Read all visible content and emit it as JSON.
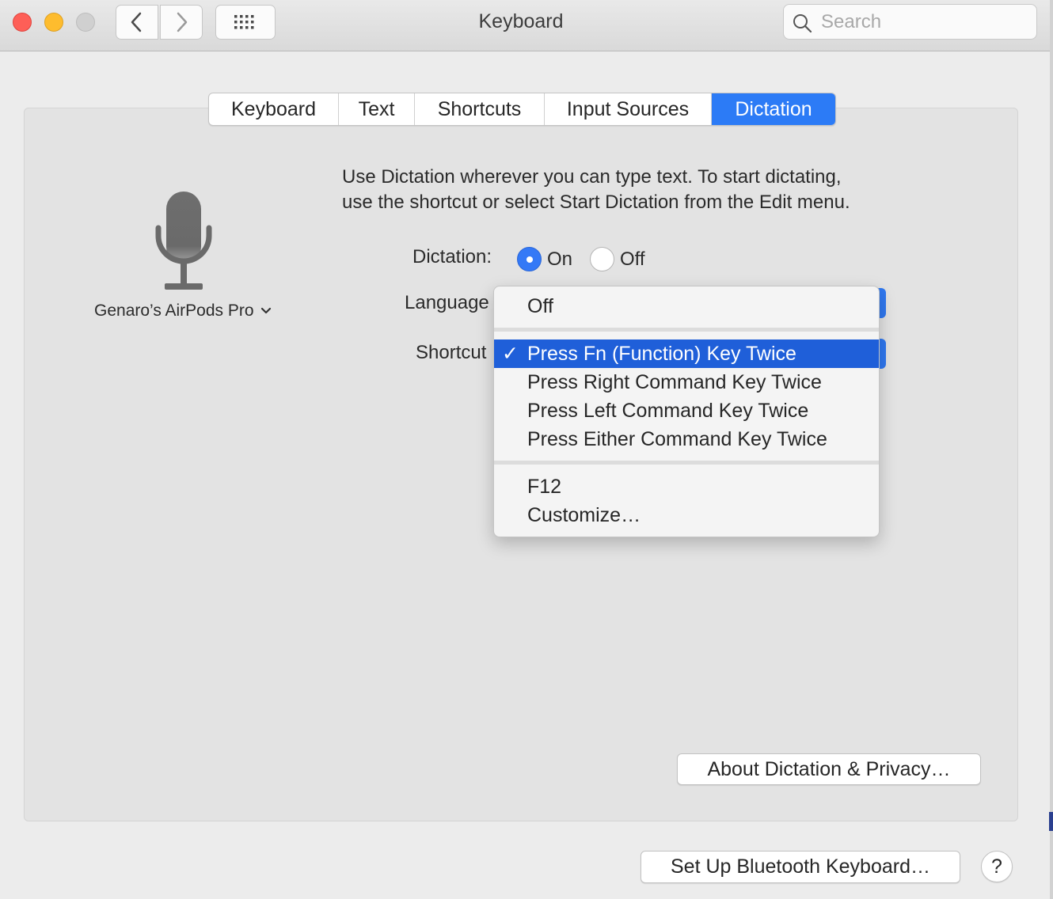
{
  "window": {
    "title": "Keyboard"
  },
  "toolbar": {
    "search_placeholder": "Search"
  },
  "tabs": [
    {
      "label": "Keyboard",
      "active": false
    },
    {
      "label": "Text",
      "active": false
    },
    {
      "label": "Shortcuts",
      "active": false
    },
    {
      "label": "Input Sources",
      "active": false
    },
    {
      "label": "Dictation",
      "active": true
    }
  ],
  "dictation": {
    "description_line1": "Use Dictation wherever you can type text. To start dictating,",
    "description_line2": "use the shortcut or select Start Dictation from the Edit menu.",
    "microphone_source": "Genaro’s AirPods Pro",
    "dictation_label": "Dictation:",
    "on_label": "On",
    "off_label": "Off",
    "selected": "On",
    "language_label": "Language",
    "shortcut_label": "Shortcut"
  },
  "shortcut_menu": {
    "items": [
      {
        "label": "Off"
      },
      {
        "label": "Press Fn (Function) Key Twice",
        "checked": true
      },
      {
        "label": "Press Right Command Key Twice"
      },
      {
        "label": "Press Left Command Key Twice"
      },
      {
        "label": "Press Either Command Key Twice"
      },
      {
        "label": "F12"
      },
      {
        "label": "Customize…"
      }
    ],
    "check_mark": "✓"
  },
  "buttons": {
    "about": "About Dictation & Privacy…",
    "bluetooth": "Set Up Bluetooth Keyboard…",
    "help": "?"
  },
  "colors": {
    "accent": "#2c7bf6",
    "menu_highlight": "#1f5fd9"
  }
}
